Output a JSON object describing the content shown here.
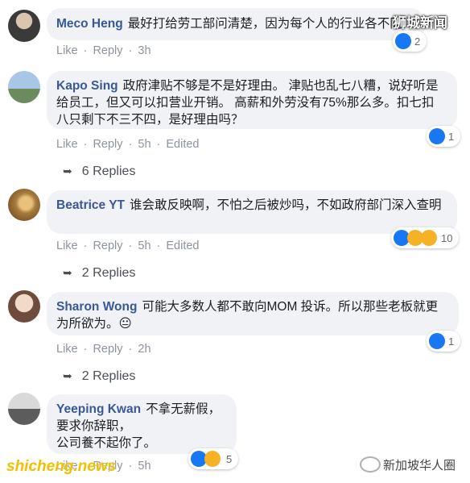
{
  "watermark_top": "狮城新闻",
  "watermark_bottom_left": "shicheng.news",
  "watermark_bottom_right": "新加坡华人圈",
  "labels": {
    "like": "Like",
    "reply": "Reply"
  },
  "comments": [
    {
      "author": "Meco Heng",
      "text": "最好打给劳工部问清楚，因为每个人的行业各不同",
      "time": "3h",
      "edited": "",
      "reactions": "2",
      "replies": ""
    },
    {
      "author": "Kapo Sing",
      "text": "政府津贴不够是不是好理由。 津贴也乱七八糟，说好听是给员工，但又可以扣营业开销。 高薪和外劳没有75%那么多。扣七扣八只剩下不三不四，是好理由吗？",
      "time": "5h",
      "edited": "Edited",
      "reactions": "1",
      "replies": "6 Replies"
    },
    {
      "author": "Beatrice YT",
      "text": "谁会敢反映啊，不怕之后被炒吗，不如政府部门深入查明",
      "time": "5h",
      "edited": "Edited",
      "reactions": "10",
      "replies": "2 Replies"
    },
    {
      "author": "Sharon Wong",
      "text": "可能大多数人都不敢向MOM 投诉。所以那些老板就更为所欲为。😐",
      "time": "2h",
      "edited": "",
      "reactions": "1",
      "replies": "2 Replies"
    },
    {
      "author": "Yeeping Kwan",
      "text_lines": [
        "不拿无薪假，",
        "要求你辞职，",
        "公司養不起你了。"
      ],
      "time": "5h",
      "edited": "",
      "reactions": "5",
      "replies": ""
    }
  ]
}
